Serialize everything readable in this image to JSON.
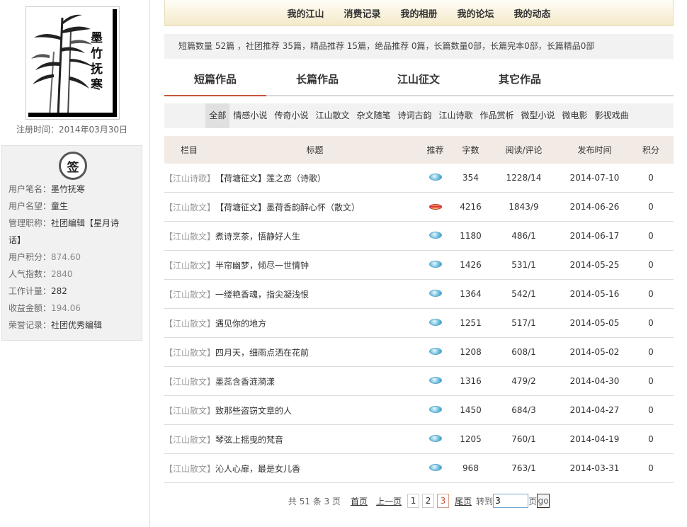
{
  "sidebar": {
    "avatar_calligraphy": "墨竹抚寒",
    "reg_time": "注册时间：2014年03月30日",
    "sign_label": "签",
    "info": [
      {
        "label": "用户笔名：",
        "value": "墨竹抚寒"
      },
      {
        "label": "用户名望：",
        "value": "童生"
      },
      {
        "label": "管理职称：",
        "value": "社团编辑【星月诗"
      },
      {
        "label": "",
        "value": "话】"
      },
      {
        "label": "用户积分：",
        "value": "874.60"
      },
      {
        "label": "人气指数：",
        "value": "2840"
      },
      {
        "label": "工作计量：",
        "value": "282"
      },
      {
        "label": "收益金额：",
        "value": "194.06"
      },
      {
        "label": "荣誉记录：",
        "value": "社团优秀编辑"
      }
    ]
  },
  "topnav": [
    "我的江山",
    "消费记录",
    "我的相册",
    "我的论坛",
    "我的动态"
  ],
  "stats": "短篇数量 52篇 ，社团推荐 35篇，精品推荐 15篇，绝品推荐 0篇，长篇数量0部，长篇完本0部，长篇精品0部",
  "tabs": [
    "短篇作品",
    "长篇作品",
    "江山征文",
    "其它作品"
  ],
  "categories": [
    "全部",
    "情感小说",
    "传奇小说",
    "江山散文",
    "杂文随笔",
    "诗词古韵",
    "江山诗歌",
    "作品赏析",
    "微型小说",
    "微电影",
    "影视戏曲"
  ],
  "table": {
    "headers": [
      "栏目",
      "标题",
      "推荐",
      "字数",
      "阅读/评论",
      "发布时间",
      "积分"
    ],
    "rows": [
      {
        "col": "【江山诗歌】",
        "title": "【荷塘征文】莲之恋（诗歌）",
        "rec": "blue",
        "words": "354",
        "read": "1228/14",
        "date": "2014-07-10",
        "score": "0"
      },
      {
        "col": "【江山散文】",
        "title": "【荷塘征文】墨荷香韵醉心怀（散文）",
        "rec": "red",
        "words": "4216",
        "read": "1843/9",
        "date": "2014-06-26",
        "score": "0"
      },
      {
        "col": "【江山散文】",
        "title": "煮诗烹茶，悟静好人生",
        "rec": "blue",
        "words": "1180",
        "read": "486/1",
        "date": "2014-06-17",
        "score": "0"
      },
      {
        "col": "【江山散文】",
        "title": "半帘幽梦，倾尽一世情钟",
        "rec": "blue",
        "words": "1426",
        "read": "531/1",
        "date": "2014-05-25",
        "score": "0"
      },
      {
        "col": "【江山散文】",
        "title": "一缕艳香魂，指尖凝浅恨",
        "rec": "blue",
        "words": "1364",
        "read": "542/1",
        "date": "2014-05-16",
        "score": "0"
      },
      {
        "col": "【江山散文】",
        "title": "遇见你的地方",
        "rec": "blue",
        "words": "1251",
        "read": "517/1",
        "date": "2014-05-05",
        "score": "0"
      },
      {
        "col": "【江山散文】",
        "title": "四月天，细雨点洒在花前",
        "rec": "blue",
        "words": "1208",
        "read": "608/1",
        "date": "2014-05-02",
        "score": "0"
      },
      {
        "col": "【江山散文】",
        "title": "墨蕊含香涟漪漾",
        "rec": "blue",
        "words": "1316",
        "read": "479/2",
        "date": "2014-04-30",
        "score": "0"
      },
      {
        "col": "【江山散文】",
        "title": "致那些盗窃文章的人",
        "rec": "blue",
        "words": "1450",
        "read": "684/3",
        "date": "2014-04-27",
        "score": "0"
      },
      {
        "col": "【江山散文】",
        "title": "琴弦上摇曳的梵音",
        "rec": "blue",
        "words": "1205",
        "read": "760/1",
        "date": "2014-04-19",
        "score": "0"
      },
      {
        "col": "【江山散文】",
        "title": "沁人心扉，最是女儿香",
        "rec": "blue",
        "words": "968",
        "read": "763/1",
        "date": "2014-03-31",
        "score": "0"
      }
    ]
  },
  "pager": {
    "summary": "共 51 条 3 页",
    "first": "首页",
    "prev": "上一页",
    "pages": [
      "1",
      "2",
      "3"
    ],
    "current": "3",
    "last": "尾页",
    "goto": "转到",
    "page_value": "3",
    "page_unit": "页",
    "go": "go"
  }
}
